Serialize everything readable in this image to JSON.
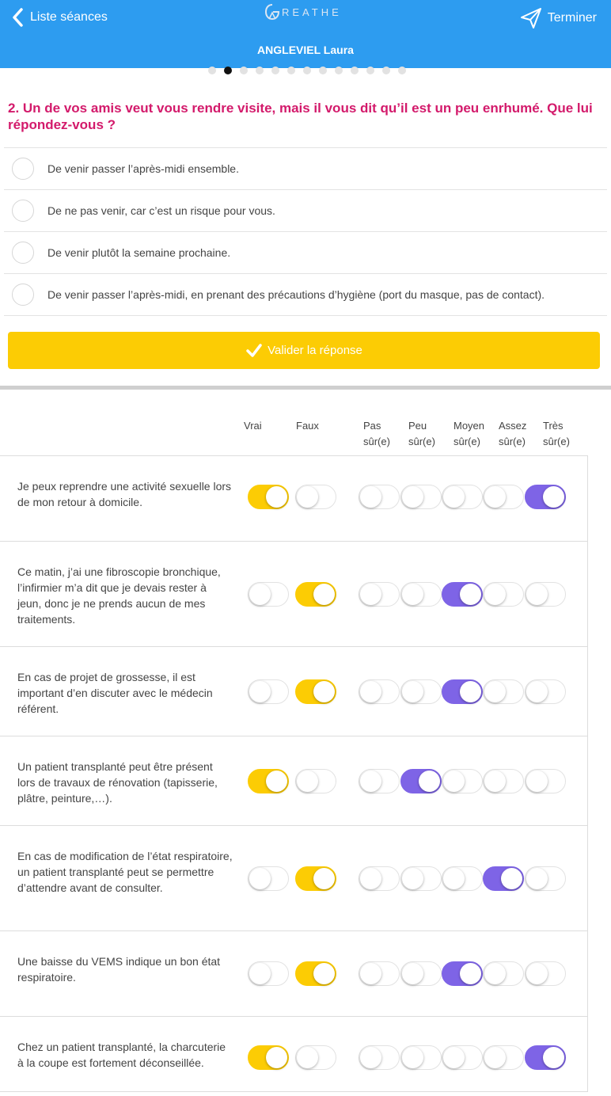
{
  "header": {
    "back_label": "Liste séances",
    "logo_text": "REATHE",
    "finish_label": "Terminer",
    "patient_name": "ANGLEVIEL Laura"
  },
  "pagination": {
    "count": 13,
    "active": 1
  },
  "question": {
    "text": "2. Un de vos amis veut vous rendre visite, mais il vous dit qu’il est un peu enrhumé. Que lui répondez-vous ?",
    "options": [
      "De venir passer l’après-midi ensemble.",
      "De ne pas venir, car c’est un risque pour vous.",
      "De venir plutôt la semaine prochaine.",
      "De venir passer l’après-midi, en prenant des précautions d’hygiène (port du masque, pas de contact)."
    ],
    "validate_label": "Valider la réponse"
  },
  "columns": {
    "vrai": "Vrai",
    "faux": "Faux",
    "confidence": [
      {
        "line1": "Pas",
        "line2": "sûr(e)"
      },
      {
        "line1": "Peu",
        "line2": "sûr(e)"
      },
      {
        "line1": "Moyen",
        "line2": "sûr(e)"
      },
      {
        "line1": "Assez",
        "line2": "sûr(e)"
      },
      {
        "line1": "Très",
        "line2": "sûr(e)"
      }
    ]
  },
  "statements": [
    {
      "text": "Je peux reprendre une activité sexuelle lors de mon retour à domicile.",
      "answer": "vrai",
      "confidence": 4
    },
    {
      "text": "Ce matin, j’ai une fibroscopie bronchique, l’infirmier m’a dit que je devais rester à jeun, donc je ne prends aucun de mes traitements.",
      "answer": "faux",
      "confidence": 2
    },
    {
      "text": "En cas de projet de grossesse, il est important d’en discuter avec le médecin référent.",
      "answer": "faux",
      "confidence": 2
    },
    {
      "text": "Un patient transplanté peut être présent lors de travaux de rénovation (tapisserie, plâtre, peinture,…).",
      "answer": "vrai",
      "confidence": 1
    },
    {
      "text": "En cas de modification de l’état respiratoire, un patient transplanté peut se permettre d’attendre avant de consulter.",
      "answer": "faux",
      "confidence": 3
    },
    {
      "text": "Une baisse du VEMS indique un bon état respiratoire.",
      "answer": "faux",
      "confidence": 2
    },
    {
      "text": "Chez un patient transplanté, la charcuterie à la coupe est fortement déconseillée.",
      "answer": "vrai",
      "confidence": 4
    }
  ],
  "colors": {
    "header": "#2d9cf0",
    "question": "#d31a6b",
    "yellow": "#fccc04",
    "purple": "#7e64e6"
  }
}
